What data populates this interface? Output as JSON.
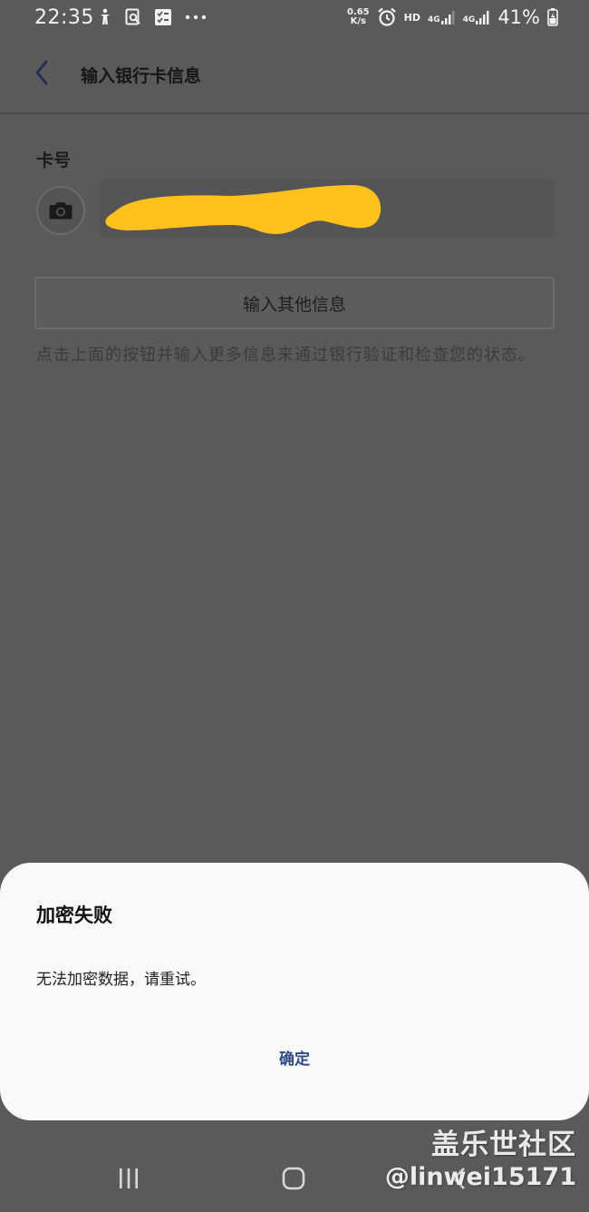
{
  "status_bar": {
    "time": "22:35",
    "net_speed_value": "0.65",
    "net_speed_unit": "K/s",
    "hd_label": "HD",
    "network_1": "4G",
    "network_2": "4G",
    "battery_percent": "41%"
  },
  "header": {
    "title": "输入银行卡信息"
  },
  "card": {
    "label": "卡号"
  },
  "other_info_button": {
    "label": "输入其他信息"
  },
  "hint": {
    "text": "点击上面的按钮并输入更多信息来通过银行验证和检查您的状态。"
  },
  "dialog": {
    "title": "加密失败",
    "message": "无法加密数据，请重试。",
    "confirm_label": "确定"
  },
  "watermark": {
    "site": "盖乐世社区",
    "user": "@linwei15171"
  },
  "colors": {
    "overlay_background": "#5a5a5a",
    "dialog_background": "#f9f9f9",
    "dialog_action": "#2f4a86",
    "redaction_yellow": "#ffc21c"
  },
  "icons": {
    "back": "back-arrow-icon",
    "camera": "camera-icon",
    "recents": "recent-apps-icon",
    "home": "home-icon",
    "nav_back": "nav-back-icon"
  }
}
